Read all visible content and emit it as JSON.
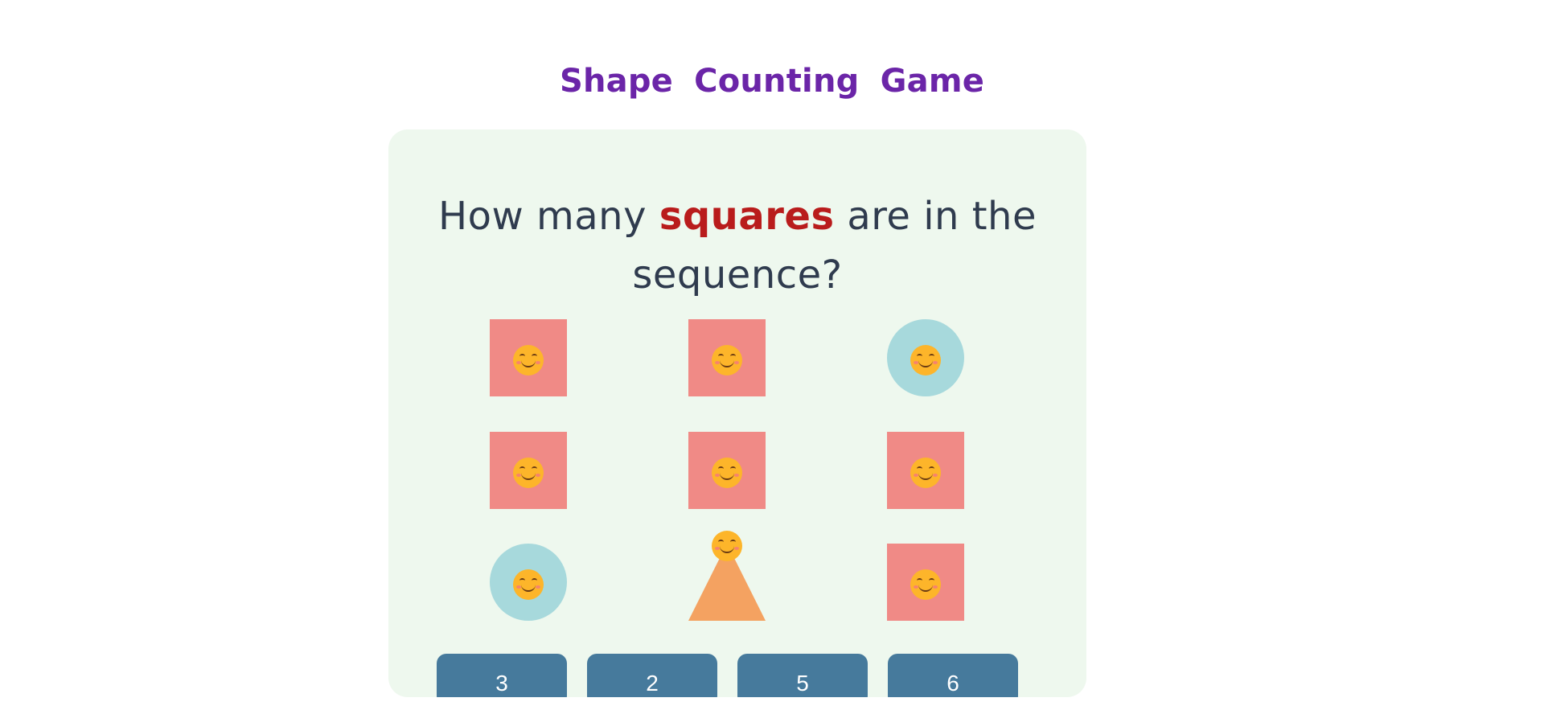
{
  "game": {
    "title": "Shape Counting Game",
    "question_before": "How many",
    "question_highlight": "squares",
    "question_after": "are in the sequence?",
    "answers": [
      "3",
      "2",
      "5",
      "6"
    ],
    "shapes": [
      {
        "shape": "square",
        "face_icon": "smiling-face-icon"
      },
      {
        "shape": "square",
        "face_icon": "smiling-face-icon"
      },
      {
        "shape": "circle",
        "face_icon": "smiling-face-icon"
      },
      {
        "shape": "square",
        "face_icon": "smiling-face-icon"
      },
      {
        "shape": "square",
        "face_icon": "smiling-face-icon"
      },
      {
        "shape": "square",
        "face_icon": "smiling-face-icon"
      },
      {
        "shape": "circle",
        "face_icon": "smiling-face-icon"
      },
      {
        "shape": "triangle",
        "face_icon": "smiling-face-icon"
      },
      {
        "shape": "square",
        "face_icon": "smiling-face-icon"
      }
    ],
    "colors": {
      "title": "#6b25a8",
      "highlight": "#b91c1c",
      "square": "#f08a86",
      "circle": "#a7d9dc",
      "triangle": "#f4a261",
      "button": "#467a9c",
      "panel": "#eef8ee"
    }
  }
}
